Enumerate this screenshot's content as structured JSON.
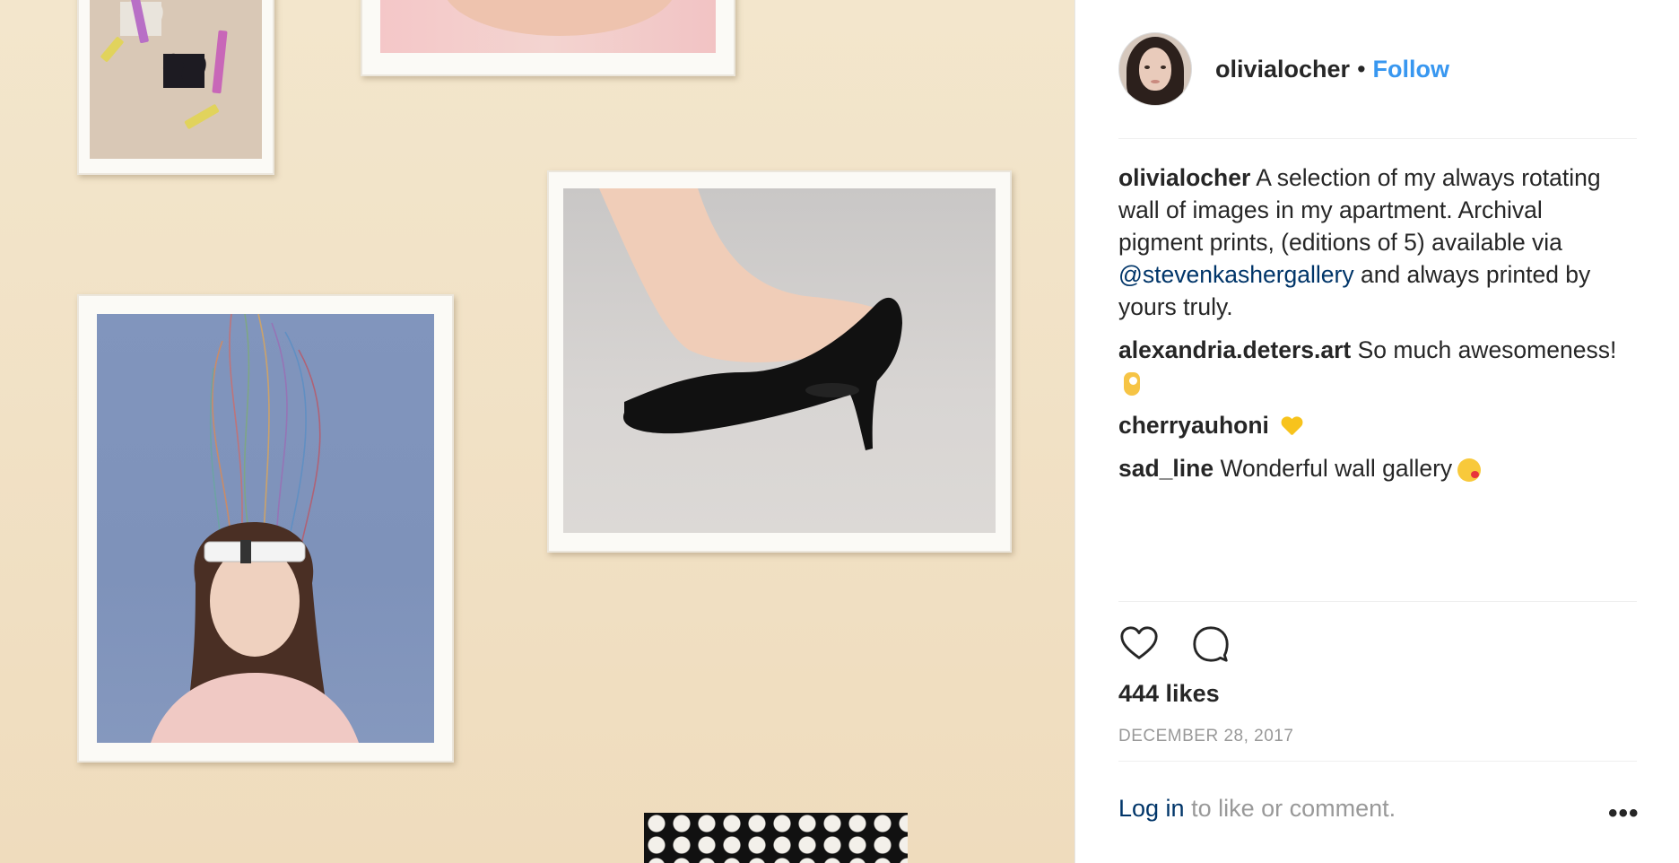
{
  "post": {
    "username": "olivialocher",
    "separator": "•",
    "follow_label": "Follow",
    "caption": {
      "user": "olivialocher",
      "text_before": "A selection of my always rotating wall of images in my apartment. Archival pigment prints, (editions of 5) available via",
      "mention": "@stevenkashergallery",
      "text_after": "and always printed by yours truly."
    },
    "comments": [
      {
        "user": "alexandria.deters.art",
        "text": "So much awesomeness!",
        "emoji": "ok-hand-emoji"
      },
      {
        "user": "cherryauhoni",
        "text": "",
        "emoji": "yellow-heart-emoji"
      },
      {
        "user": "sad_line",
        "text": "Wonderful wall gallery",
        "emoji": "kissing-face-emoji"
      }
    ],
    "actions": {
      "like_icon": "heart-icon",
      "comment_icon": "comment-icon"
    },
    "likes": "444 likes",
    "date": "DECEMBER 28, 2017",
    "login": {
      "link_label": "Log in",
      "suffix": "to like or comment."
    },
    "more_label": "•••"
  },
  "colors": {
    "accent": "#3897f0",
    "link": "#003569",
    "muted": "#999999",
    "text": "#262626"
  }
}
